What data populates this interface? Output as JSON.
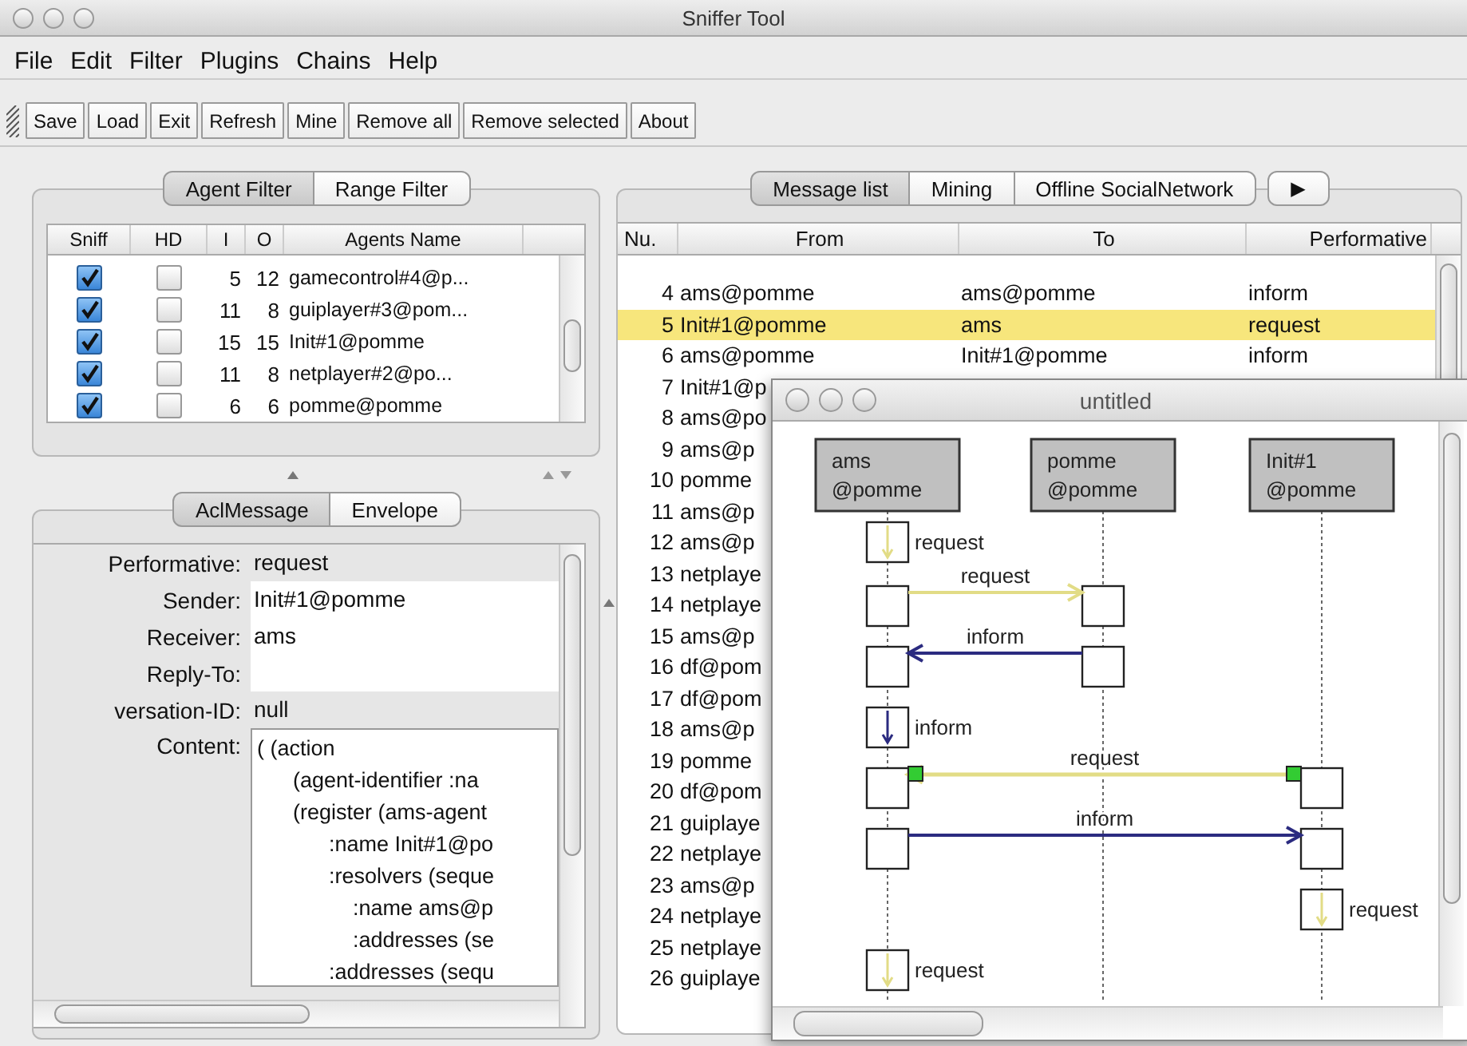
{
  "main_window": {
    "title": "Sniffer Tool"
  },
  "menu": [
    "File",
    "Edit",
    "Filter",
    "Plugins",
    "Chains",
    "Help"
  ],
  "toolbar": [
    "Save",
    "Load",
    "Exit",
    "Refresh",
    "Mine",
    "Remove all",
    "Remove selected",
    "About"
  ],
  "agent_panel": {
    "tabs": [
      {
        "label": "Agent Filter",
        "selected": true
      },
      {
        "label": "Range Filter",
        "selected": false
      }
    ],
    "columns": [
      "Sniff",
      "HD",
      "I",
      "O",
      "Agents Name"
    ],
    "rows": [
      {
        "sniff": true,
        "hd": false,
        "in": "5",
        "out": "12",
        "name": "gamecontrol#4@p..."
      },
      {
        "sniff": true,
        "hd": false,
        "in": "11",
        "out": "8",
        "name": "guiplayer#3@pom..."
      },
      {
        "sniff": true,
        "hd": false,
        "in": "15",
        "out": "15",
        "name": "Init#1@pomme"
      },
      {
        "sniff": true,
        "hd": false,
        "in": "11",
        "out": "8",
        "name": "netplayer#2@po..."
      },
      {
        "sniff": true,
        "hd": false,
        "in": "6",
        "out": "6",
        "name": "pomme@pomme"
      }
    ]
  },
  "acl_panel": {
    "tabs": [
      {
        "label": "AclMessage",
        "selected": true
      },
      {
        "label": "Envelope",
        "selected": false
      }
    ],
    "fields": [
      {
        "label": "Performative:",
        "value": "request",
        "editable": false
      },
      {
        "label": "Sender:",
        "value": "Init#1@pomme",
        "editable": true
      },
      {
        "label": "Receiver:",
        "value": "ams",
        "editable": true
      },
      {
        "label": "Reply-To:",
        "editable": true
      },
      {
        "label": "versation-ID:",
        "value": "null",
        "editable": false
      }
    ],
    "content_label": "Content:",
    "content": "( (action\n      (agent-identifier :na\n      (register (ams-agent\n            :name Init#1@po\n            :resolvers (seque\n                :name ams@p\n                :addresses (se\n            :addresses (sequ"
  },
  "message_panel": {
    "tabs": [
      {
        "label": "Message list",
        "selected": true
      },
      {
        "label": "Mining",
        "selected": false
      },
      {
        "label": "Offline SocialNetwork",
        "selected": false
      }
    ],
    "more_button": "▶",
    "columns": [
      "Nu.",
      "From",
      "To",
      "Performative"
    ],
    "rows": [
      {
        "number": "4",
        "from": "ams@pomme",
        "to": "ams@pomme",
        "performative": "inform",
        "selected": false
      },
      {
        "number": "5",
        "from": "Init#1@pomme",
        "to": "ams",
        "performative": "request",
        "selected": true
      },
      {
        "number": "6",
        "from": "ams@pomme",
        "to": "Init#1@pomme",
        "performative": "inform",
        "selected": false
      },
      {
        "number": "7",
        "from": "Init#1@p",
        "selected": false
      },
      {
        "number": "8",
        "from": "ams@po",
        "selected": false
      },
      {
        "number": "9",
        "from": "ams@p",
        "selected": false
      },
      {
        "number": "10",
        "from": "pomme",
        "selected": false
      },
      {
        "number": "11",
        "from": "ams@p",
        "selected": false
      },
      {
        "number": "12",
        "from": "ams@p",
        "selected": false
      },
      {
        "number": "13",
        "from": "netplaye",
        "selected": false
      },
      {
        "number": "14",
        "from": "netplaye",
        "selected": false
      },
      {
        "number": "15",
        "from": "ams@p",
        "selected": false
      },
      {
        "number": "16",
        "from": "df@pom",
        "selected": false
      },
      {
        "number": "17",
        "from": "df@pom",
        "selected": false
      },
      {
        "number": "18",
        "from": "ams@p",
        "selected": false
      },
      {
        "number": "19",
        "from": "pomme",
        "selected": false
      },
      {
        "number": "20",
        "from": "df@pom",
        "selected": false
      },
      {
        "number": "21",
        "from": "guiplaye",
        "selected": false
      },
      {
        "number": "22",
        "from": "netplaye",
        "selected": false
      },
      {
        "number": "23",
        "from": "ams@p",
        "selected": false
      },
      {
        "number": "24",
        "from": "netplaye",
        "selected": false
      },
      {
        "number": "25",
        "from": "netplaye",
        "selected": false
      },
      {
        "number": "26",
        "from": "guiplaye",
        "selected": false
      }
    ]
  },
  "diagram_window": {
    "title": "untitled",
    "agents": [
      {
        "name": "ams",
        "host": "@pomme"
      },
      {
        "name": "pomme",
        "host": "@pomme"
      },
      {
        "name": "Init#1",
        "host": "@pomme"
      }
    ],
    "messages": [
      {
        "label": "request",
        "kind": "self",
        "color": "#e2dc86",
        "selected": false
      },
      {
        "label": "request",
        "kind": "right",
        "color": "#e2dc86",
        "selected": false
      },
      {
        "label": "inform",
        "kind": "left",
        "color": "#2b2b80",
        "selected": false
      },
      {
        "label": "inform",
        "kind": "self",
        "color": "#2b2b80",
        "selected": false
      },
      {
        "label": "request",
        "kind": "left",
        "color": "#e2dc86",
        "selected": true
      },
      {
        "label": "inform",
        "kind": "right",
        "color": "#2b2b80",
        "selected": false
      },
      {
        "label": "request",
        "kind": "self",
        "color": "#e2dc86",
        "selected": false
      },
      {
        "label": "request",
        "kind": "self",
        "color": "#e2dc86",
        "selected": false
      }
    ]
  }
}
